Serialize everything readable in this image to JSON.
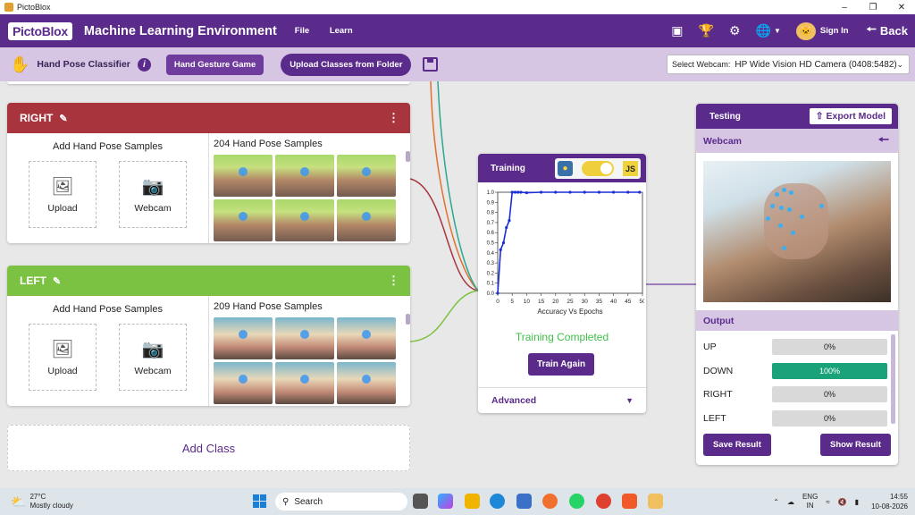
{
  "window": {
    "title": "PictoBlox"
  },
  "topbar": {
    "logo": "PictoBlox",
    "title": "Machine Learning Environment",
    "menu": [
      "File",
      "Learn"
    ],
    "sign_in": "Sign In",
    "back": "Back"
  },
  "subbar": {
    "classifier_title": "Hand Pose Classifier",
    "gesture_game": "Hand Gesture Game",
    "upload_classes": "Upload Classes from Folder",
    "webcam_label": "Select Webcam:",
    "webcam_value": "HP Wide Vision HD Camera (0408:5482)"
  },
  "classes": [
    {
      "name": "RIGHT",
      "color": "#a8343e",
      "add_label": "Add Hand Pose Samples",
      "count_label": "204 Hand Pose Samples",
      "upload": "Upload",
      "webcam": "Webcam"
    },
    {
      "name": "LEFT",
      "color": "#7cc242",
      "add_label": "Add Hand Pose Samples",
      "count_label": "209 Hand Pose Samples",
      "upload": "Upload",
      "webcam": "Webcam"
    }
  ],
  "add_class": "Add Class",
  "training": {
    "title": "Training",
    "status": "Training Completed",
    "train_again": "Train Again",
    "advanced": "Advanced"
  },
  "chart_data": {
    "type": "line",
    "title": "",
    "xlabel": "Accuracy Vs Epochs",
    "ylabel": "",
    "xlim": [
      0,
      50
    ],
    "ylim": [
      0,
      1.0
    ],
    "xticks": [
      0,
      5,
      10,
      15,
      20,
      25,
      30,
      35,
      40,
      45,
      50
    ],
    "yticks": [
      0.0,
      0.1,
      0.2,
      0.3,
      0.4,
      0.5,
      0.6,
      0.7,
      0.8,
      0.9,
      1.0
    ],
    "series": [
      {
        "name": "",
        "color": "#1a2fd6",
        "x": [
          0,
          1,
          2,
          3,
          4,
          5,
          6,
          7,
          8,
          10,
          15,
          20,
          25,
          30,
          35,
          40,
          45,
          49
        ],
        "y": [
          0.0,
          0.43,
          0.5,
          0.65,
          0.72,
          1.0,
          1.0,
          1.0,
          1.0,
          0.995,
          1.0,
          1.0,
          1.0,
          1.0,
          1.0,
          1.0,
          1.0,
          1.0
        ]
      }
    ],
    "grid": false
  },
  "testing": {
    "title": "Testing",
    "export": "Export Model",
    "webcam": "Webcam",
    "output_title": "Output",
    "outputs": [
      {
        "label": "UP",
        "value": "0%",
        "fraction": 0
      },
      {
        "label": "DOWN",
        "value": "100%",
        "fraction": 1
      },
      {
        "label": "RIGHT",
        "value": "0%",
        "fraction": 0
      },
      {
        "label": "LEFT",
        "value": "0%",
        "fraction": 0
      }
    ],
    "save_result": "Save Result",
    "show_result": "Show Result"
  },
  "taskbar": {
    "temp": "27°C",
    "weather": "Mostly cloudy",
    "search": "Search",
    "lang1": "ENG",
    "lang2": "IN",
    "time": "14:55",
    "date": "10-08-2026"
  }
}
